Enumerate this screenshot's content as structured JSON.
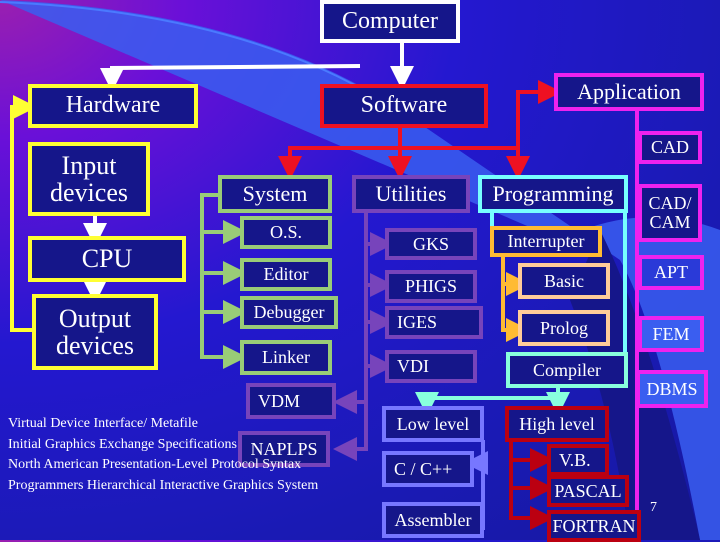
{
  "root": "Computer",
  "hardware": {
    "title": "Hardware",
    "items": [
      "Input devices",
      "CPU",
      "Output devices"
    ]
  },
  "software": {
    "title": "Software",
    "system": {
      "title": "System",
      "items": [
        "O.S.",
        "Editor",
        "Debugger",
        "Linker"
      ]
    },
    "utilities": {
      "title": "Utilities",
      "items": [
        "GKS",
        "PHIGS",
        "IGES",
        "VDI",
        "VDM",
        "NAPLPS"
      ]
    },
    "programming": {
      "title": "Programming",
      "interpreter": {
        "title": "Interrupter",
        "items": [
          "Basic",
          "Prolog"
        ]
      },
      "compiler": {
        "title": "Compiler",
        "low_level": {
          "title": "Low level",
          "items": [
            "C / C++",
            "Assembler"
          ]
        },
        "high_level": {
          "title": "High level",
          "items": [
            "V.B.",
            "PASCAL",
            "FORTRAN"
          ]
        }
      }
    }
  },
  "application": {
    "title": "Application",
    "items": [
      "CAD",
      "CAD/ CAM",
      "APT",
      "FEM",
      "DBMS"
    ]
  },
  "legend": [
    "Virtual Device Interface/ Metafile",
    "Initial Graphics Exchange Specifications",
    "North American Presentation-Level Protocol Syntax",
    "Programmers Hierarchical Interactive Graphics System"
  ],
  "page_number": "7",
  "colors": {
    "hardware": "#ffff33",
    "root": "#ffffff",
    "software": "#ee1122",
    "application": "#ee22ee",
    "system": "#99cc77",
    "utilities": "#7744bb",
    "programming": "#77ffff",
    "interpreter": "#ffbb33",
    "compiler": "#88ffdd",
    "low_level": "#7777ff",
    "high_level": "#bb0011"
  }
}
